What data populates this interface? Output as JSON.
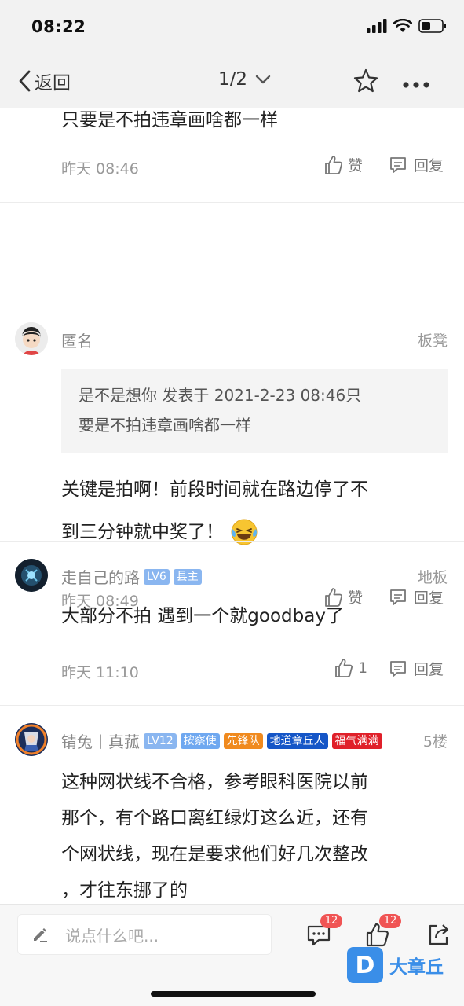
{
  "status_bar": {
    "time": "08:22"
  },
  "nav": {
    "back_label": "返回",
    "page_indicator": "1/2"
  },
  "posts": [
    {
      "text_lines": [
        "只要是不拍违章画啥都一样"
      ],
      "time": "昨天 08:46",
      "like_label": "赞",
      "reply_label": "回复"
    },
    {
      "username": "匿名",
      "floor": "板凳",
      "quote_lines": [
        "是不是想你 发表于 2021-2-23 08:46只",
        "要是不拍违章画啥都一样"
      ],
      "text_lines": [
        "关键是拍啊！前段时间就在路边停了不",
        "到三分钟就中奖了！"
      ],
      "time": "昨天 08:49",
      "like_label": "赞",
      "reply_label": "回复"
    },
    {
      "username": "走自己的路",
      "badges": [
        {
          "text": "LV6",
          "color": "#8ab6f0"
        },
        {
          "text": "县主",
          "color": "#8ab6f0"
        }
      ],
      "floor": "地板",
      "text_lines": [
        "大部分不拍   遇到一个就goodbay了"
      ],
      "time": "昨天 11:10",
      "like_label": "1",
      "reply_label": "回复"
    },
    {
      "username": "锖兔丨真菰",
      "badges": [
        {
          "text": "LV12",
          "color": "#8ab6f0"
        },
        {
          "text": "按察使",
          "color": "#6fa8f0"
        },
        {
          "text": "先锋队",
          "color": "#f08a1e"
        },
        {
          "text": "地道章丘人",
          "color": "#1556c7"
        },
        {
          "text": "福气满满",
          "color": "#e0202a"
        }
      ],
      "floor": "5楼",
      "text_lines": [
        "这种网状线不合格，参考眼科医院以前",
        "那个，有个路口离红绿灯这么近，还有",
        "个网状线，现在是要求他们好几次整改",
        "，才往东挪了的"
      ]
    }
  ],
  "bottom_bar": {
    "comment_placeholder": "说点什么吧...",
    "comment_count": "12",
    "like_count": "12",
    "watermark_text": "大章丘",
    "watermark_logo": "D"
  }
}
